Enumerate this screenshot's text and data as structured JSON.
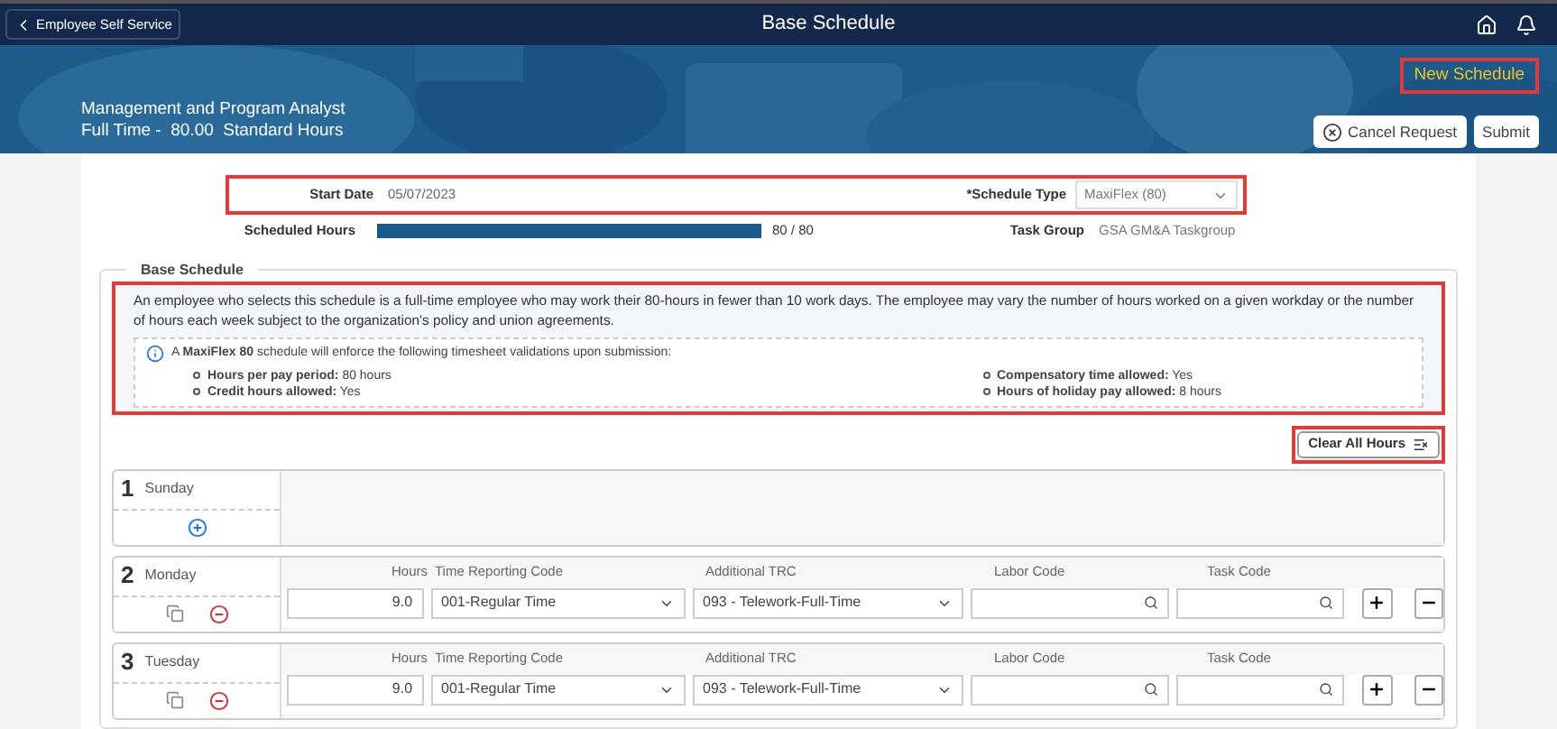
{
  "top_bar": {
    "back_label": "Employee Self Service",
    "title": "Base Schedule"
  },
  "banner": {
    "job_title": "Management and Program Analyst",
    "hours_line": "Full Time -  80.00  Standard Hours",
    "status": "New Schedule",
    "buttons": [
      "Cancel Request",
      "Submit"
    ]
  },
  "form": {
    "start_date_label": "Start Date",
    "start_date": "05/07/2023",
    "schedule_type_label": "*Schedule Type",
    "schedule_type": "MaxiFlex (80)",
    "scheduled_hours_label": "Scheduled Hours",
    "scheduled_hours": {
      "level": 1,
      "reading": "80 / 80"
    },
    "task_group_label": "Task Group",
    "task_group": "GSA GM&A Taskgroup"
  },
  "base_schedule": {
    "title": "Base Schedule",
    "description": "An employee who selects this schedule is a full-time employee who may work their 80-hours in fewer than 10 work days. The employee may vary the number of hours worked on a given workday or the number of hours each week subject to the organization's policy and union agreements.",
    "notice": "A **MaxiFlex 80** schedule will enforce the following timesheet validations upon submission:",
    "rules": [
      {
        "label": "Hours per pay period:",
        "value": "80 hours"
      },
      {
        "label": "Credit hours allowed:",
        "value": "Yes"
      },
      {
        "label": "Compensatory time allowed:",
        "value": "Yes"
      },
      {
        "label": "Hours of holiday pay allowed:",
        "value": "8 hours"
      }
    ],
    "clear_button": "Clear All Hours",
    "days": [
      {
        "number": "1",
        "name": "Sunday"
      },
      {
        "number": "2",
        "name": "Monday",
        "entries": [
          {
            "columns": [
              "Hours",
              "Time Reporting Code",
              "Additional TRC",
              "Labor Code",
              "Task Code"
            ],
            "hours": "9.0",
            "trc": "001-Regular Time",
            "additional_trc": "093 - Telework-Full-Time"
          }
        ]
      },
      {
        "number": "3",
        "name": "Tuesday",
        "entries": [
          {
            "columns": [
              "Hours",
              "Time Reporting Code",
              "Additional TRC",
              "Labor Code",
              "Task Code"
            ],
            "hours": "9.0",
            "trc": "001-Regular Time",
            "additional_trc": "093 - Telework-Full-Time"
          }
        ]
      }
    ]
  }
}
